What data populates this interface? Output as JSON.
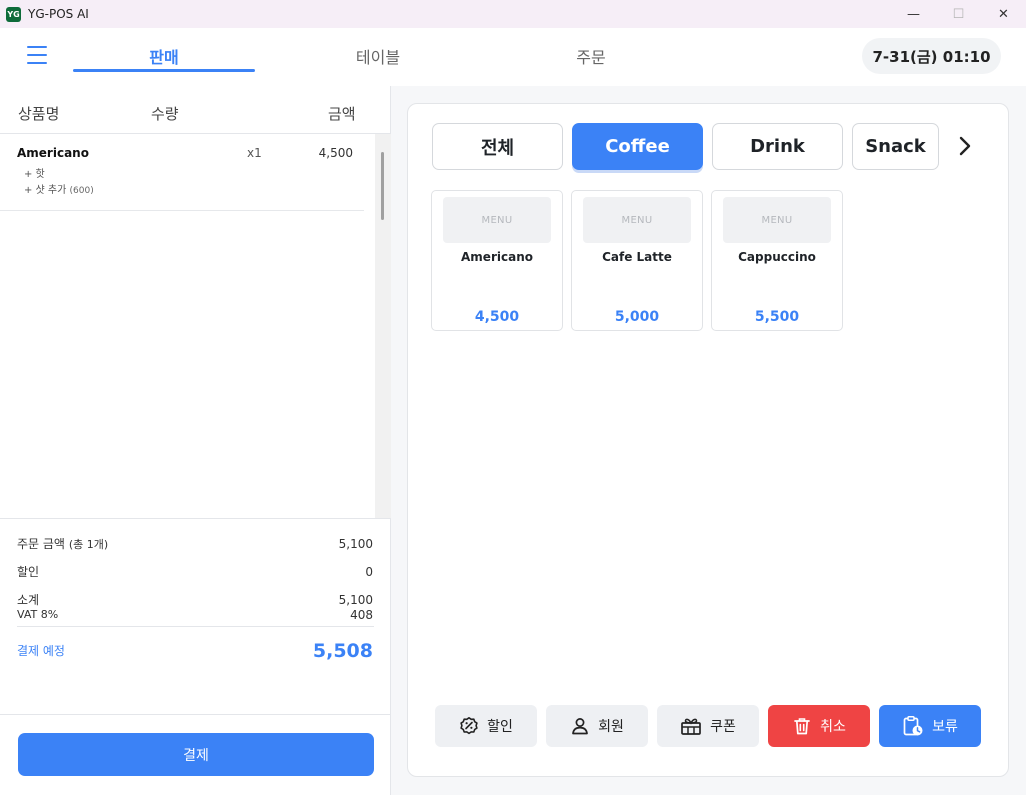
{
  "window": {
    "app_icon_text": "YG",
    "title": "YG-POS AI",
    "minimize": "—",
    "maximize": "☐",
    "close": "✕"
  },
  "nav": {
    "tabs": [
      "판매",
      "테이블",
      "주문"
    ],
    "active_tab": "판매",
    "clock": "7-31(금) 01:10"
  },
  "order": {
    "headers": {
      "name": "상품명",
      "qty": "수량",
      "amount": "금액"
    },
    "items": [
      {
        "name": "Americano",
        "qty": "x1",
        "price": "4,500",
        "options": [
          {
            "label": "+ 핫",
            "price": ""
          },
          {
            "label": "+ 샷 추가",
            "price": "(600)"
          }
        ]
      }
    ]
  },
  "summary": {
    "order_amount_label": "주문 금액",
    "order_count": "(총 1개)",
    "order_amount": "5,100",
    "discount_label": "할인",
    "discount": "0",
    "subtotal_label": "소계",
    "subtotal": "5,100",
    "vat_label": "VAT 8%",
    "vat": "408",
    "total_label": "결제 예정",
    "total": "5,508",
    "pay_button": "결제"
  },
  "categories": {
    "items": [
      "전체",
      "Coffee",
      "Drink",
      "Snack"
    ],
    "active": "Coffee"
  },
  "menu": {
    "thumb_label": "MENU",
    "items": [
      {
        "name": "Americano",
        "price": "4,500"
      },
      {
        "name": "Cafe Latte",
        "price": "5,000"
      },
      {
        "name": "Cappuccino",
        "price": "5,500"
      }
    ]
  },
  "actions": [
    {
      "label": "할인",
      "icon": "discount-icon",
      "style": "default"
    },
    {
      "label": "회원",
      "icon": "user-icon",
      "style": "default"
    },
    {
      "label": "쿠폰",
      "icon": "coupon-icon",
      "style": "default"
    },
    {
      "label": "취소",
      "icon": "trash-icon",
      "style": "danger"
    },
    {
      "label": "보류",
      "icon": "hold-clipboard-icon",
      "style": "primary"
    }
  ],
  "colors": {
    "accent": "#3b82f6",
    "danger": "#ef4444",
    "titlebar": "#f6eef7"
  }
}
